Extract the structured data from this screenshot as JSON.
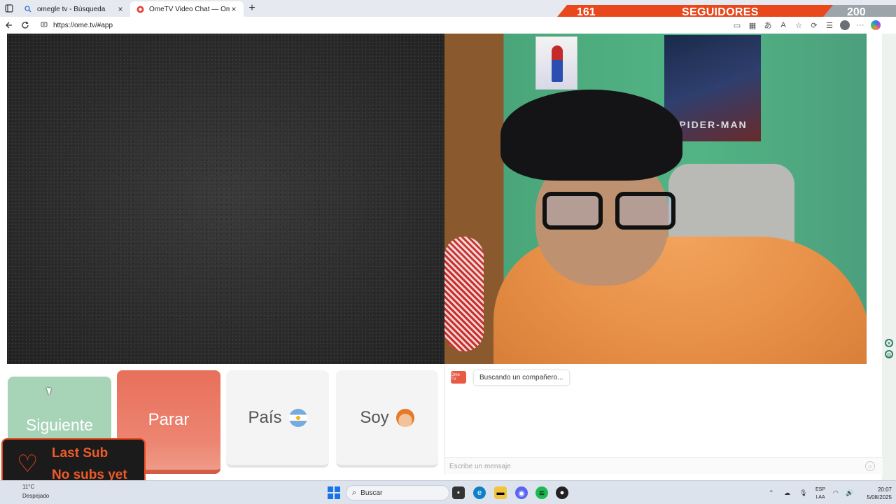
{
  "browser": {
    "tabs": [
      {
        "title": "omegle tv - Búsqueda",
        "active": false,
        "favicon": "search-icon"
      },
      {
        "title": "OmeTV Video Chat — Omegle",
        "active": true,
        "favicon": "ometv-icon"
      }
    ],
    "url": "https://ome.tv/#app"
  },
  "overlay": {
    "followers_current": "161",
    "followers_label": "SEGUIDORES",
    "followers_goal": "200",
    "last_sub_title": "Last Sub",
    "last_sub_value": "No subs yet",
    "accent_color": "#e8481c"
  },
  "controls": {
    "next_label": "Siguiente",
    "stop_label": "Parar",
    "country_label": "País",
    "gender_label": "Soy"
  },
  "chat": {
    "logo_text": "Ome TV",
    "status_message": "Buscando un compañero...",
    "input_placeholder": "Escribe un mensaje"
  },
  "poster": {
    "text": "SPIDER-MAN"
  },
  "taskbar": {
    "weather_temp": "11°C",
    "weather_desc": "Despejado",
    "search_placeholder": "Buscar",
    "lang_line1": "ESP",
    "lang_line2": "LAA",
    "time": "20:07",
    "date": "5/08/2025"
  }
}
